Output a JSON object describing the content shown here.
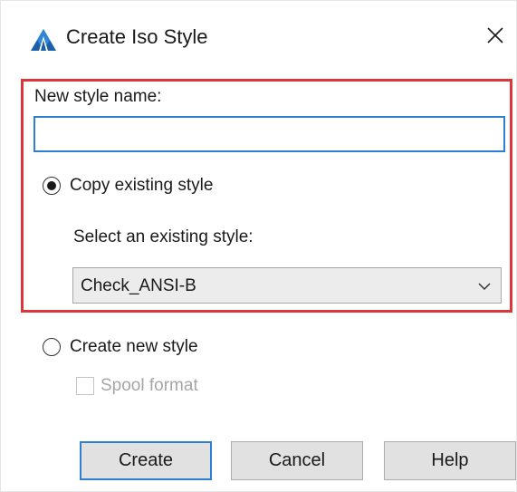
{
  "window": {
    "title": "Create Iso Style",
    "close_glyph": "✕",
    "icon": "autocad-triangle-icon",
    "accent_color": "#2f7fd1",
    "highlight_color": "#d9383a"
  },
  "form": {
    "new_style_label": "New style name:",
    "new_style_value": "",
    "new_style_placeholder": "",
    "options": {
      "copy_existing": {
        "label": "Copy existing style",
        "selected": true
      },
      "create_new": {
        "label": "Create new style",
        "selected": false
      }
    },
    "select_label": "Select an existing style:",
    "select_value": "Check_ANSI-B",
    "spool_format": {
      "label": "Spool format",
      "checked": false,
      "enabled": false
    }
  },
  "buttons": {
    "create": "Create",
    "cancel": "Cancel",
    "help": "Help"
  }
}
